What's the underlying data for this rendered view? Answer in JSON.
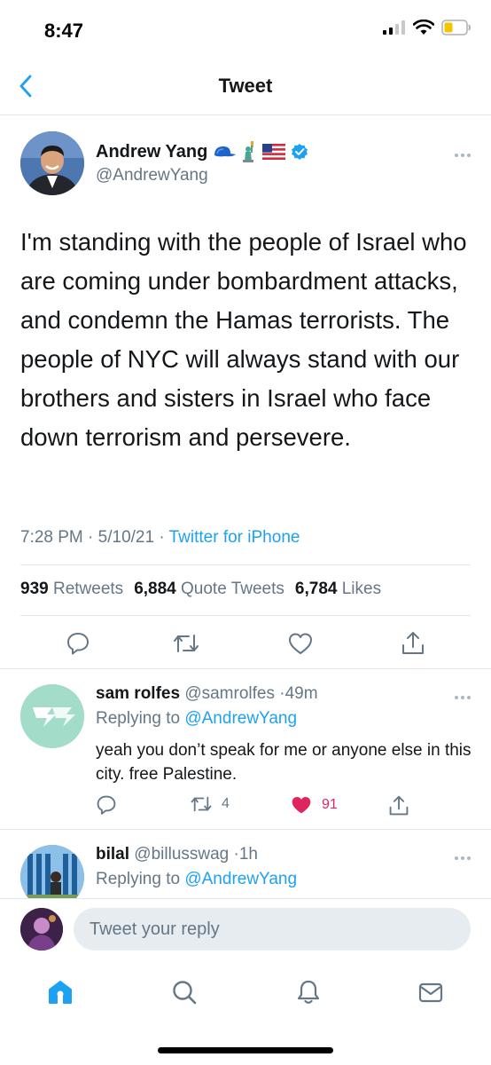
{
  "status_bar": {
    "time": "8:47"
  },
  "nav": {
    "title": "Tweet"
  },
  "tweet": {
    "author_name": "Andrew Yang",
    "name_emojis": [
      "blue-cap",
      "statue-of-liberty",
      "us-flag"
    ],
    "verified": true,
    "handle": "@AndrewYang",
    "text": "I'm standing with the people of Israel who are coming under bombardment attacks, and condemn the Hamas terrorists. The people of NYC will always stand with our brothers and sisters in Israel who face down terrorism and persevere.",
    "time": "7:28 PM",
    "date": "5/10/21",
    "source": "Twitter for iPhone",
    "stats": {
      "retweets_count": "939",
      "retweets_label": "Retweets",
      "quotes_count": "6,884",
      "quotes_label": "Quote Tweets",
      "likes_count": "6,784",
      "likes_label": "Likes"
    }
  },
  "replies": [
    {
      "name": "sam rolfes",
      "handle": "@samrolfes",
      "age": "49m",
      "replying_label": "Replying to",
      "replying_to": "@AndrewYang",
      "text": "yeah you don’t speak for me or anyone else in this city. free Palestine.",
      "retweets": "4",
      "likes": "91",
      "liked": true
    },
    {
      "name": "bilal",
      "handle": "@billusswag",
      "age": "1h",
      "replying_label": "Replying to",
      "replying_to": "@AndrewYang"
    }
  ],
  "compose": {
    "placeholder": "Tweet your reply"
  },
  "colors": {
    "accent": "#1da1f2",
    "like": "#e0245e",
    "muted": "#657786",
    "text": "#14171a"
  }
}
